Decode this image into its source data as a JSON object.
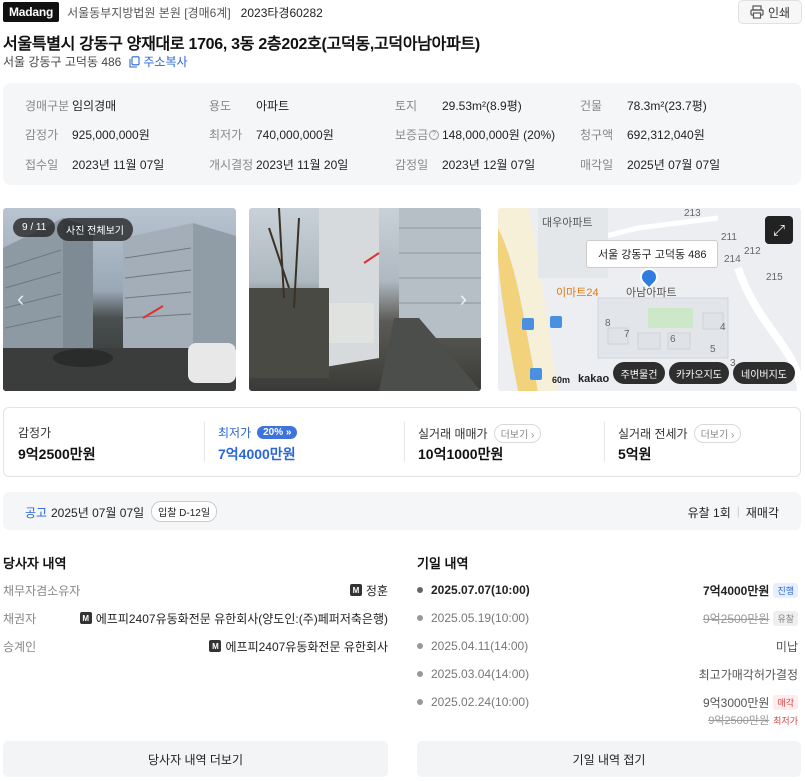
{
  "header": {
    "logo": "Madang",
    "court": "서울동부지방법원 본원 [경매6계]",
    "case_no": "2023타경60282",
    "print_label": "인쇄"
  },
  "property": {
    "title": "서울특별시 강동구 양재대로 1706, 3동 2층202호(고덕동,고덕아남아파트)",
    "short_address": "서울 강동구 고덕동 486",
    "copy_address_label": "주소복사"
  },
  "info": {
    "auction_type_label": "경매구분",
    "auction_type": "임의경매",
    "use_label": "용도",
    "use": "아파트",
    "land_label": "토지",
    "land": "29.53m²(8.9평)",
    "building_label": "건물",
    "building": "78.3m²(23.7평)",
    "appraisal_label": "감정가",
    "appraisal": "925,000,000원",
    "min_price_label": "최저가",
    "min_price": "740,000,000원",
    "deposit_label": "보증금",
    "deposit": "148,000,000원 (20%)",
    "claim_label": "청구액",
    "claim": "692,312,040원",
    "received_label": "접수일",
    "received": "2023년 11월 07일",
    "started_label": "개시결정",
    "started": "2023년 11월 20일",
    "appraised_label": "감정일",
    "appraised": "2023년 12월 07일",
    "sale_date_label": "매각일",
    "sale_date": "2025년 07월 07일"
  },
  "photos": {
    "counter": "9 / 11",
    "view_all": "사진 전체보기"
  },
  "map": {
    "popup": "서울 강동구 고덕동 486",
    "poi_daewoo": "대우아파트",
    "poi_emart": "이마트24",
    "poi_anam": "아남아파트",
    "scale": "60m",
    "brand": "kakao",
    "btn_nearby": "주변물건",
    "btn_kakao": "카카오지도",
    "btn_naver": "네이버지도",
    "numbers": [
      "213",
      "211",
      "212",
      "214",
      "215",
      "4",
      "7",
      "8",
      "5",
      "6",
      "3"
    ]
  },
  "prices": {
    "appraisal_label": "감정가",
    "appraisal": "9억2500만원",
    "min_label": "최저가",
    "min_pct": "20%",
    "min": "7억4000만원",
    "trade_label": "실거래 매매가",
    "trade": "10억1000만원",
    "lease_label": "실거래 전세가",
    "lease": "5억원",
    "more": "더보기"
  },
  "notice": {
    "label": "공고",
    "date": "2025년 07월 07일",
    "dday": "입찰 D-12일",
    "fail_count": "유찰 1회",
    "resale": "재매각"
  },
  "parties": {
    "title": "당사자 내역",
    "rows": [
      {
        "k": "채무자겸소유자",
        "v": "정훈"
      },
      {
        "k": "채권자",
        "v": "에프피2407유동화전문 유한회사(양도인:(주)페퍼저축은행)"
      },
      {
        "k": "승계인",
        "v": "에프피2407유동화전문 유한회사"
      }
    ],
    "more_button": "당사자 내역 더보기"
  },
  "dates": {
    "title": "기일 내역",
    "rows": [
      {
        "d": "2025.07.07(10:00)",
        "price": "7억4000만원",
        "tag": "진행"
      },
      {
        "d": "2025.05.19(10:00)",
        "price": "9억2500만원",
        "tag": "유찰"
      },
      {
        "d": "2025.04.11(14:00)",
        "price": "미납",
        "tag": ""
      },
      {
        "d": "2025.03.04(14:00)",
        "price": "최고가매각허가결정",
        "tag": ""
      },
      {
        "d": "2025.02.24(10:00)",
        "price": "9억3000만원",
        "tag": "매각"
      }
    ],
    "sub_price": "9억2500만원",
    "sub_tag": "최저가",
    "fold_button": "기일 내역 접기"
  }
}
